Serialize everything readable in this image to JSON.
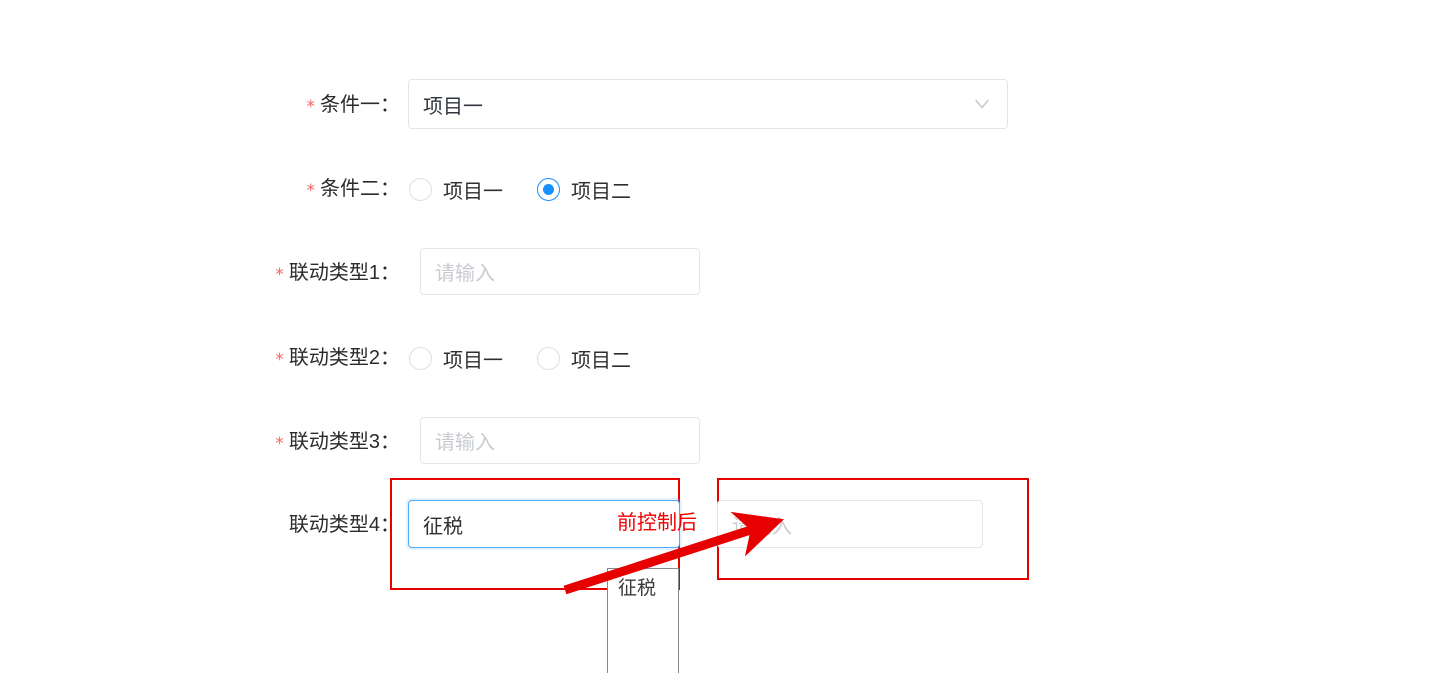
{
  "form": {
    "rows": [
      {
        "key": "condition-1",
        "label": "条件一",
        "colon": "：",
        "required": true,
        "control": "select",
        "value": "项目一",
        "caret_icon": "chevron-down-icon"
      },
      {
        "key": "condition-2",
        "label": "条件二",
        "colon": "：",
        "required": true,
        "control": "radio",
        "options": [
          {
            "label": "项目一",
            "selected": false
          },
          {
            "label": "项目二",
            "selected": true
          }
        ]
      },
      {
        "key": "linkage-type-1",
        "label": "联动类型1",
        "colon": "：",
        "required": true,
        "control": "input",
        "value": "",
        "placeholder": "请输入"
      },
      {
        "key": "linkage-type-2",
        "label": "联动类型2",
        "colon": "：",
        "required": true,
        "control": "radio",
        "options": [
          {
            "label": "项目一",
            "selected": false
          },
          {
            "label": "项目二",
            "selected": false
          }
        ]
      },
      {
        "key": "linkage-type-3",
        "label": "联动类型3",
        "colon": "：",
        "required": true,
        "control": "input",
        "value": "",
        "placeholder": "请输入"
      },
      {
        "key": "linkage-type-4",
        "label": "联动类型4",
        "colon": "：",
        "required": false,
        "control": "input-pair",
        "first": {
          "value": "征税",
          "placeholder": "请输入",
          "focused": true
        },
        "second": {
          "value": "",
          "placeholder": "请输入",
          "focused": false
        }
      }
    ]
  },
  "autocomplete": {
    "items": [
      {
        "label": "征税"
      }
    ]
  },
  "annotation": {
    "note": "前控制后",
    "arrow_icon": "arrow-up-right-icon",
    "box_count": 2,
    "color": "#e60000"
  },
  "colors": {
    "required_star": "#f5645f",
    "radio_selected": "#1890ff",
    "focus_border": "#52a9f5",
    "placeholder": "#c8cbd0",
    "annotation_red": "#e60000",
    "text": "#2f2f2f",
    "border": "#e4e6e9",
    "background": "#ffffff"
  }
}
